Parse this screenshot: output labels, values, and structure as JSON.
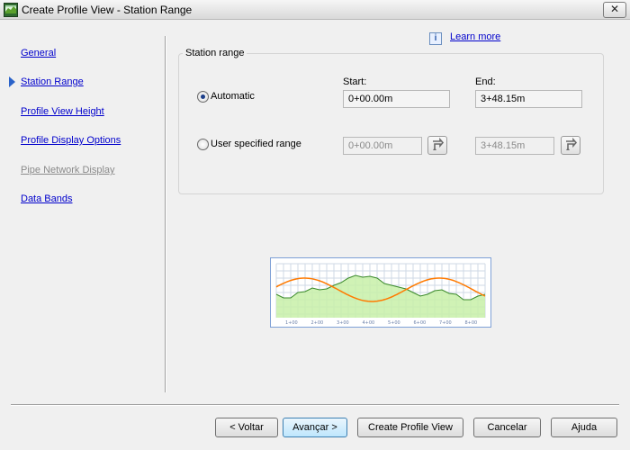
{
  "window": {
    "title": "Create Profile View - Station Range",
    "close_symbol": "✕"
  },
  "nav": {
    "items": [
      {
        "label": "General",
        "state": "enabled"
      },
      {
        "label": "Station Range",
        "state": "current"
      },
      {
        "label": "Profile View Height",
        "state": "enabled"
      },
      {
        "label": "Profile Display Options",
        "state": "enabled"
      },
      {
        "label": "Pipe Network Display",
        "state": "disabled"
      },
      {
        "label": "Data Bands",
        "state": "enabled"
      }
    ]
  },
  "help": {
    "info_glyph": "i",
    "learn_more": "Learn more"
  },
  "station_range": {
    "group_title": "Station range",
    "start_header": "Start:",
    "end_header": "End:",
    "automatic": {
      "label": "Automatic",
      "selected": true,
      "start": "0+00.00m",
      "end": "3+48.15m"
    },
    "user_specified": {
      "label": "User specified range",
      "selected": false,
      "start": "0+00.00m",
      "end": "3+48.15m"
    }
  },
  "preview": {
    "station_labels": [
      "1+00",
      "2+00",
      "3+00",
      "4+00",
      "5+00",
      "6+00",
      "7+00",
      "8+00"
    ],
    "colors": {
      "grid": "#cfd8e6",
      "ground_fill": "#c8f0a8",
      "ground_line": "#3a8a2a",
      "profile_line": "#ff7a00",
      "border": "#7ea0d6"
    }
  },
  "buttons": {
    "back": "< Voltar",
    "next": "Avançar >",
    "create": "Create Profile View",
    "cancel": "Cancelar",
    "help": "Ajuda"
  }
}
